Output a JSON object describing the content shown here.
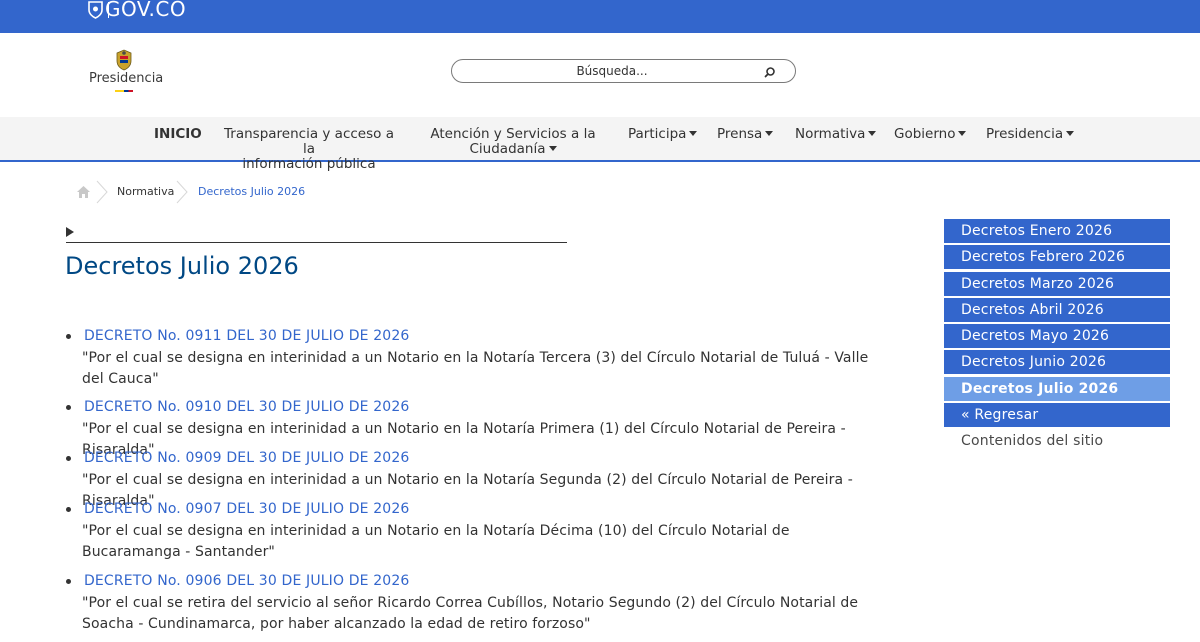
{
  "govbar": {
    "brand": "GOV.CO"
  },
  "header": {
    "logo_text": "Presidencia",
    "search_placeholder": "Búsqueda..."
  },
  "nav": {
    "items": [
      {
        "label": "INICIO"
      },
      {
        "label": "Transparencia y acceso a la",
        "label2": "información pública"
      },
      {
        "label": "Atención y Servicios a la",
        "label2": "Ciudadanía"
      },
      {
        "label": "Participa"
      },
      {
        "label": "Prensa"
      },
      {
        "label": "Normativa"
      },
      {
        "label": "Gobierno"
      },
      {
        "label": "Presidencia"
      }
    ]
  },
  "breadcrumb": {
    "item1": "Normativa",
    "item2": "Decretos Julio 2026"
  },
  "main": {
    "title": "Decretos Julio 2026",
    "decrees": [
      {
        "link": "DECRETO No. 0911 DEL 30 DE JULIO DE 2026",
        "desc": "\"Por el cual se designa en interinidad a un Notario en la Notaría Tercera (3) del Círculo Notarial de Tuluá - Valle del Cauca\""
      },
      {
        "link": "DECRETO No. 0910 DEL 30 DE JULIO DE 2026",
        "desc": "\"Por el cual se designa en interinidad a un Notario en la Notaría Primera (1) del Círculo Notarial de Pereira - Risaralda\""
      },
      {
        "link": "DECRETO No. 0909 DEL 30 DE JULIO DE 2026",
        "desc": "\"Por el cual se designa en interinidad a un Notario en la Notaría Segunda (2) del Círculo Notarial de Pereira - Risaralda\""
      },
      {
        "link": "DECRETO No. 0907 DEL 30 DE JULIO DE 2026",
        "desc": "\"Por el cual se designa en interinidad a un Notario en la Notaría Décima (10) del Círculo Notarial de Bucaramanga - Santander\""
      },
      {
        "link": "DECRETO No. 0906 DEL 30 DE JULIO DE 2026",
        "desc": "\"Por el cual se retira del servicio al señor Ricardo Correa Cubíllos, Notario Segundo (2) del Círculo Notarial de Soacha - Cundinamarca, por haber alcanzado la edad de retiro forzoso\""
      }
    ]
  },
  "sidebar": {
    "items": [
      {
        "label": "Decretos Enero 2026"
      },
      {
        "label": "Decretos Febrero 2026"
      },
      {
        "label": "Decretos Marzo 2026"
      },
      {
        "label": "Decretos Abril 2026"
      },
      {
        "label": "Decretos Mayo 2026"
      },
      {
        "label": "Decretos Junio 2026"
      },
      {
        "label": "Decretos Julio 2026"
      },
      {
        "label": "« Regresar"
      },
      {
        "label": "Contenidos del sitio"
      }
    ]
  },
  "colors": {
    "gov_blue": "#3366cc",
    "title_blue": "#004884",
    "active_item": "#6e9ee6"
  },
  "icons": [
    "shield-icon",
    "crest-icon",
    "search-icon",
    "home-icon",
    "chevron-right-icon",
    "play-triangle-icon",
    "caret-down-icon"
  ]
}
